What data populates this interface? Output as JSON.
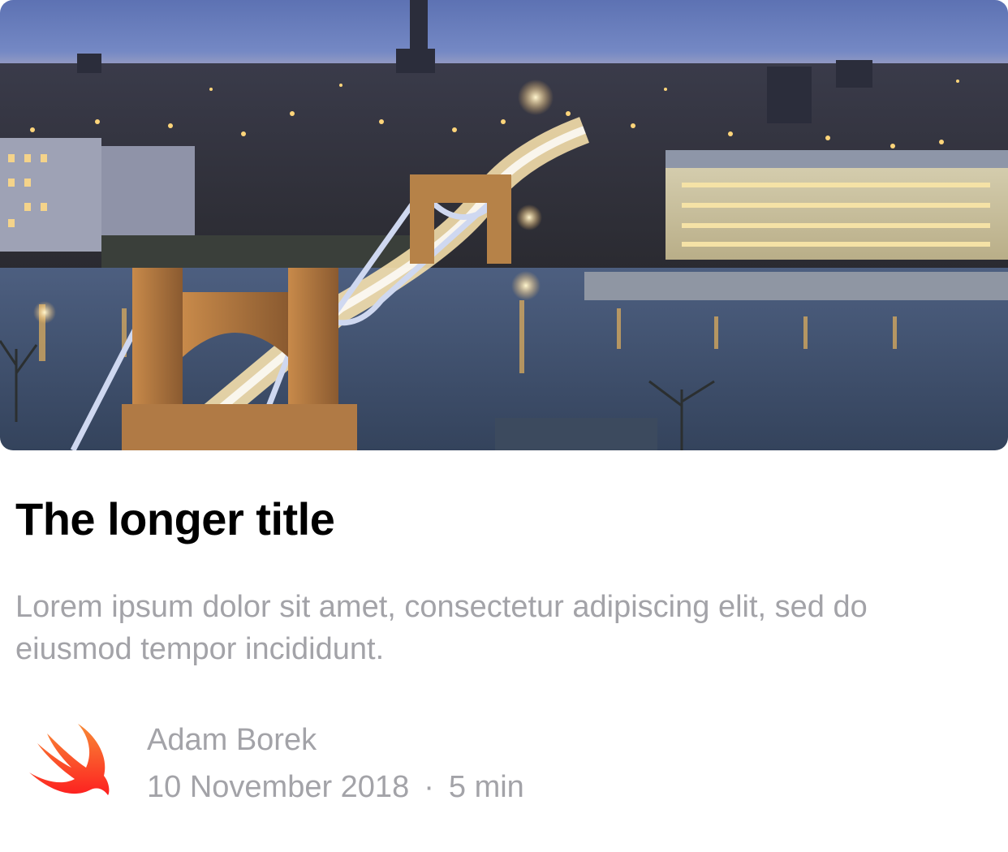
{
  "article": {
    "hero_image": "night-city-bridge-photo",
    "title": "The longer title",
    "summary": "Lorem ipsum dolor sit amet, consectetur adipiscing elit, sed do eiusmod tempor incididunt.",
    "author": "Adam Borek",
    "date": "10 November 2018",
    "separator": "·",
    "read_time": "5 min",
    "author_logo": "swift-logo-icon"
  },
  "colors": {
    "title": "#000000",
    "secondary_text": "#a3a3a8",
    "logo_gradient_top": "#f88a36",
    "logo_gradient_bottom": "#fd2020"
  }
}
